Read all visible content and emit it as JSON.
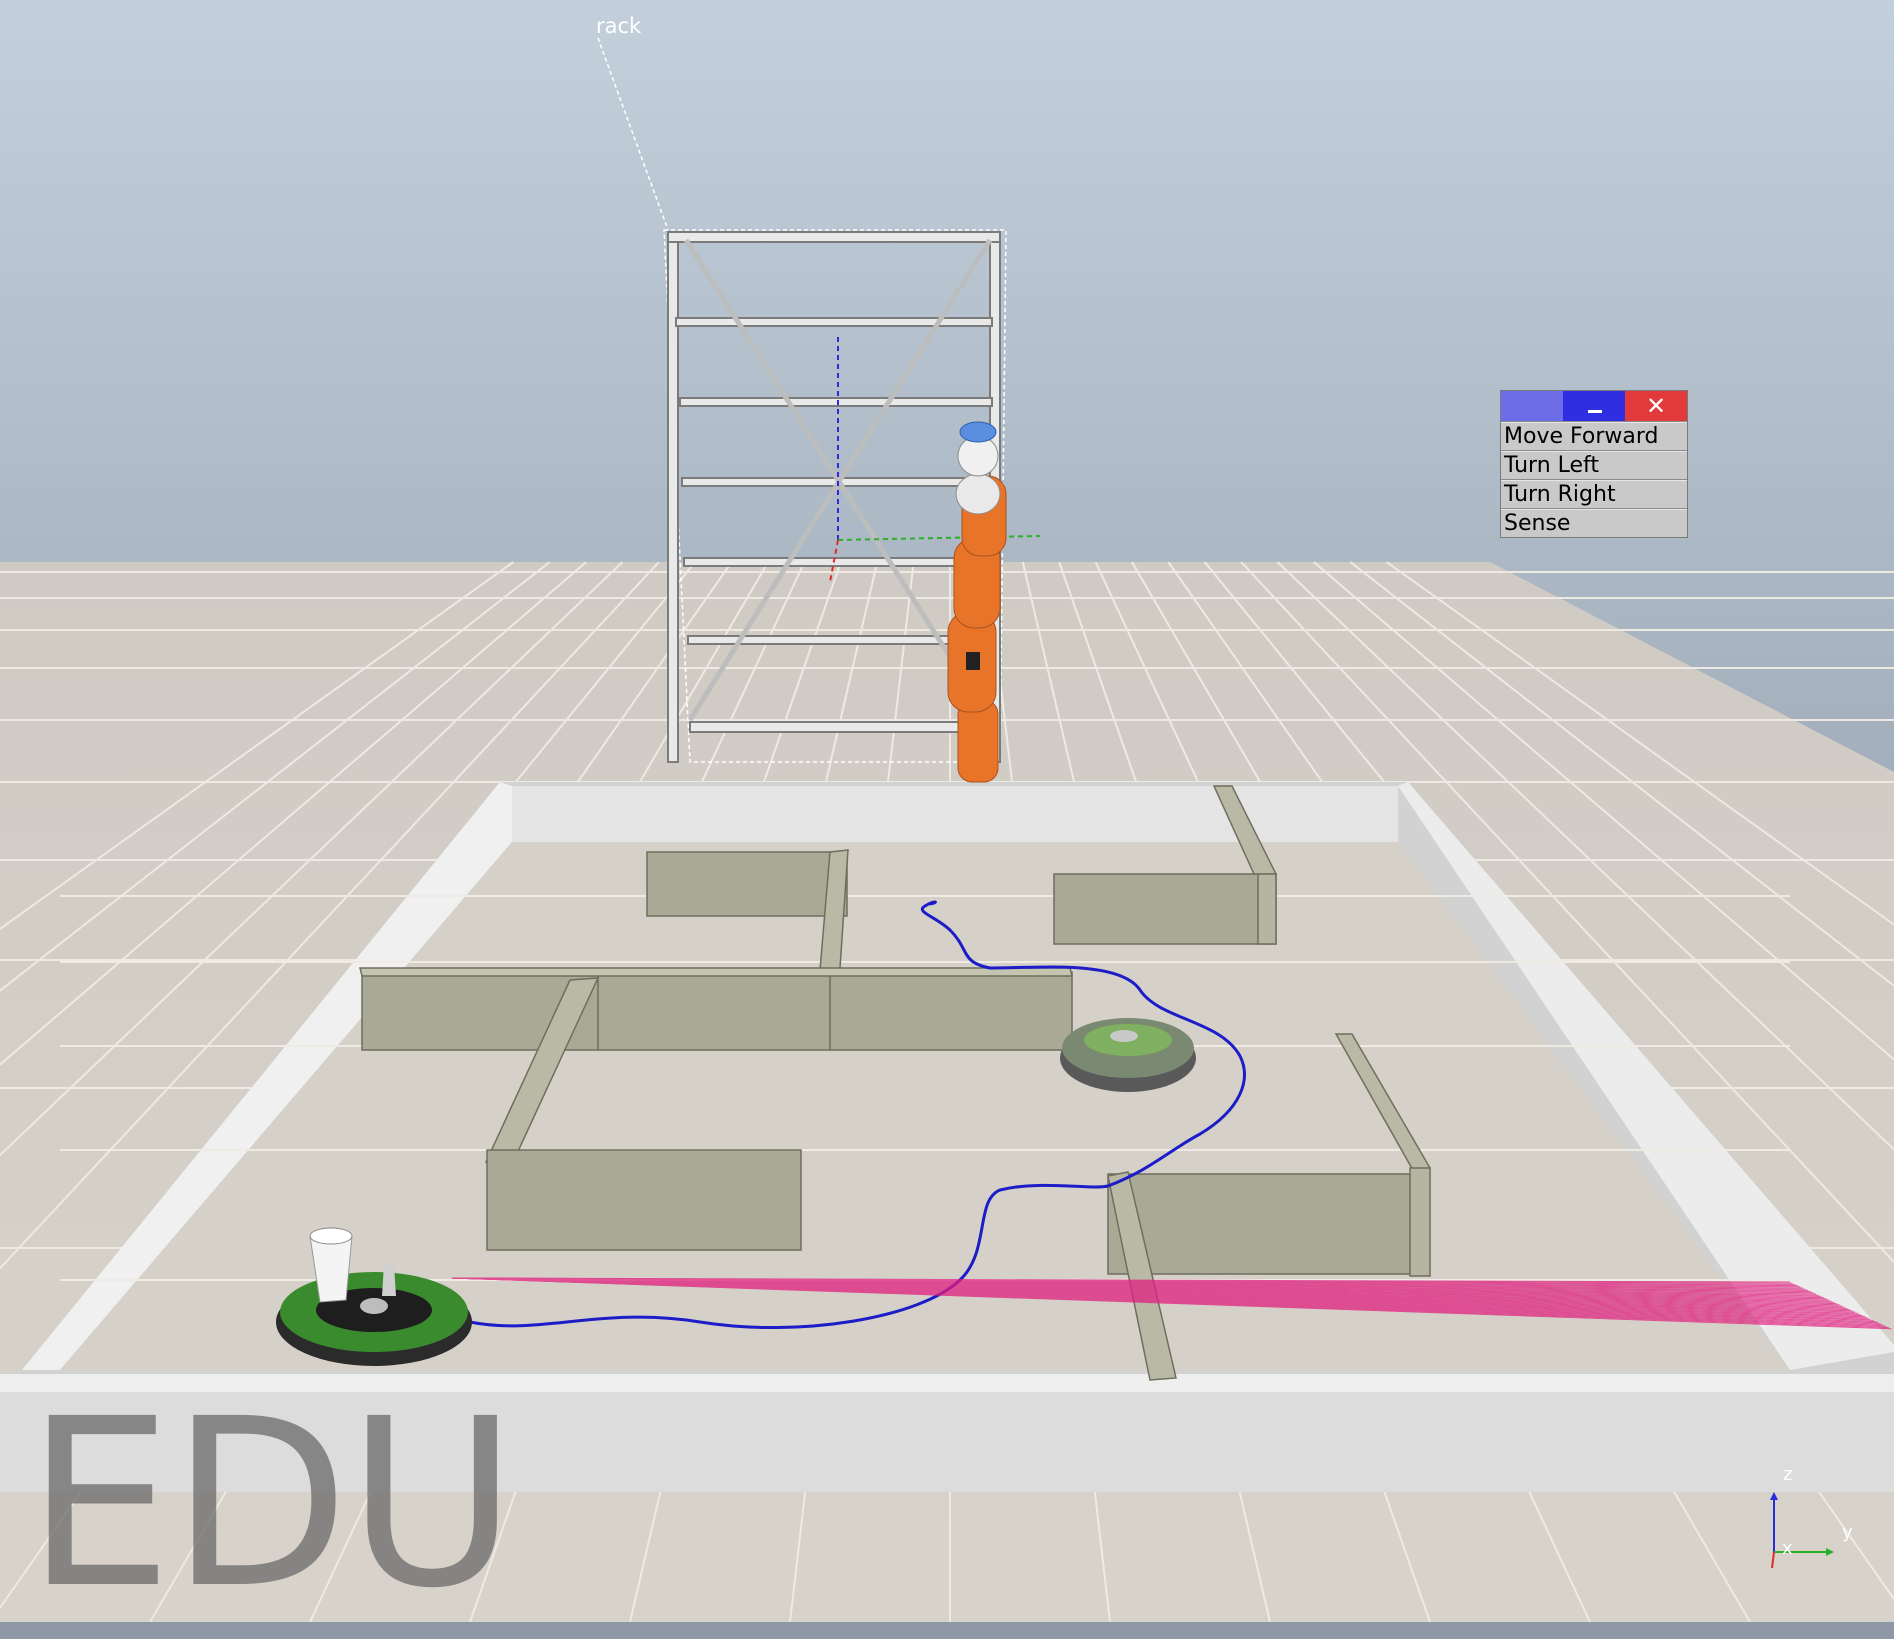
{
  "scene": {
    "selected_object_label": "rack",
    "watermark": "EDU"
  },
  "command_window": {
    "close_glyph": "✕",
    "items": [
      "Move Forward",
      "Turn Left",
      "Turn Right",
      "Sense"
    ]
  },
  "axes_gizmo": {
    "z": "z",
    "y": "y",
    "x": "x"
  },
  "colors": {
    "sky_top": "#c2d0dc",
    "floor_tile": "#cbc6bd",
    "maze_wall": "#a9a995",
    "robot_arm": "#e8742a",
    "path": "#1c1cc8",
    "laser": "#e0207f",
    "titlebar_blue": "#2f2ee0",
    "titlebar_close": "#e23a3a"
  }
}
